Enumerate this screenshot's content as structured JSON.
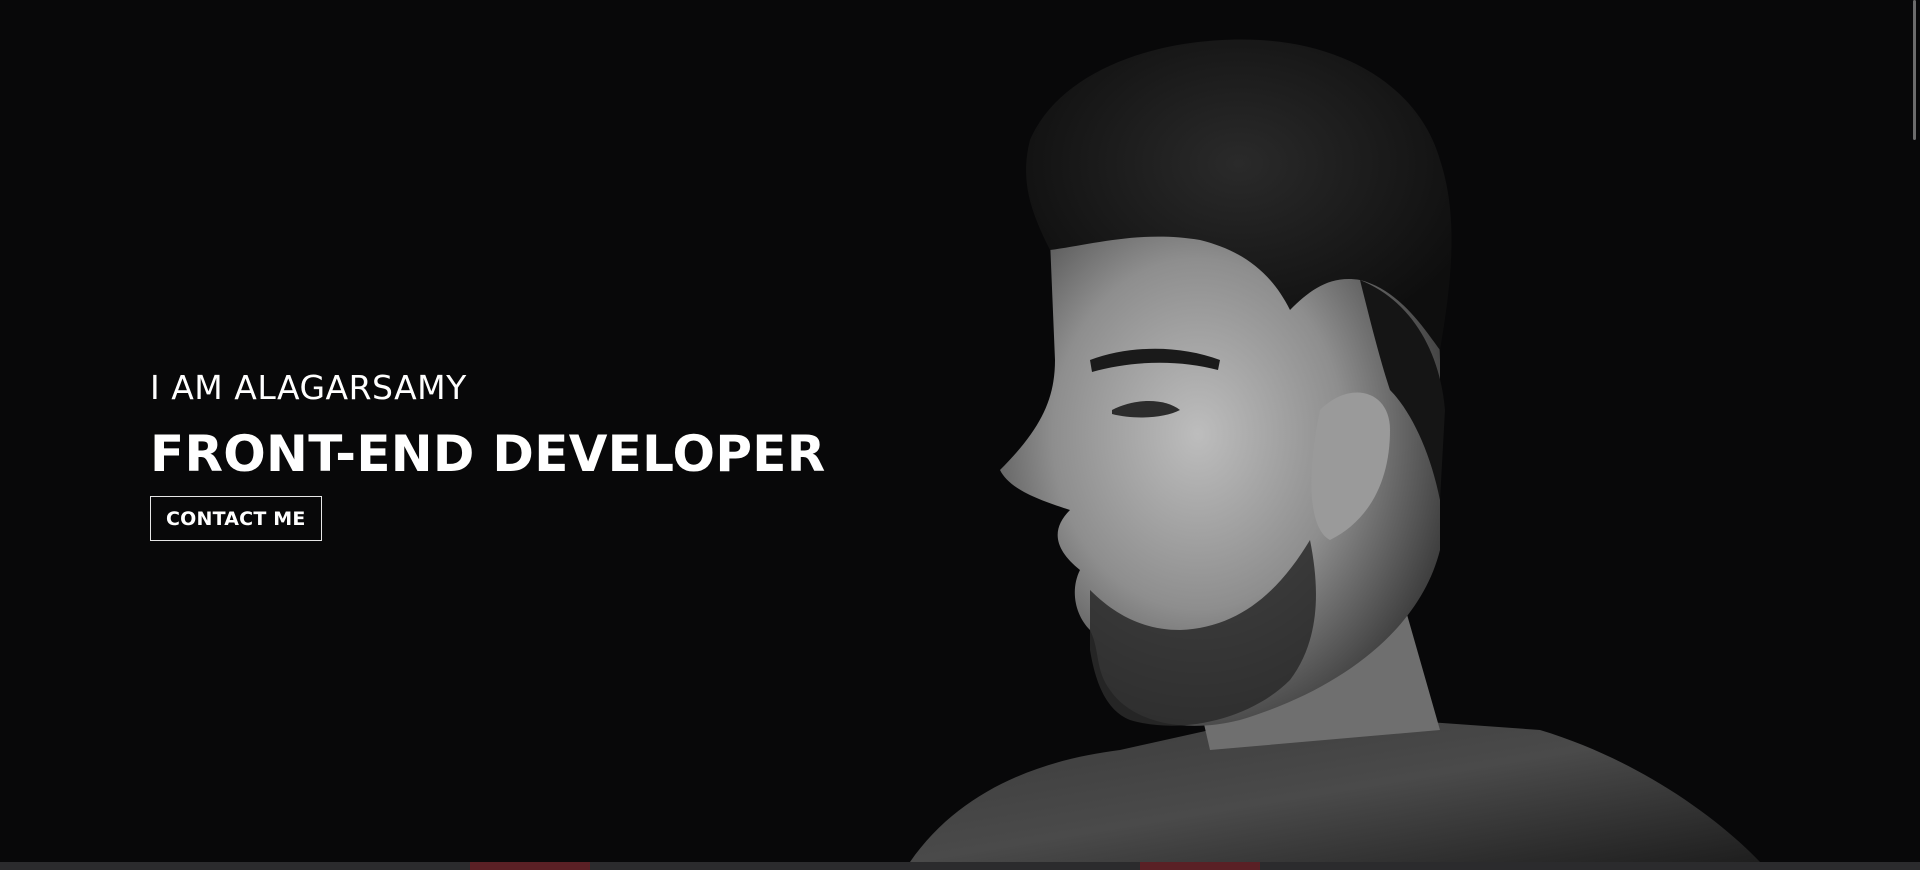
{
  "hero": {
    "intro": "I AM ALAGARSAMY",
    "role": "FRONT-END DEVELOPER",
    "contact_label": "CONTACT ME"
  },
  "colors": {
    "background": "#080809",
    "text": "#ffffff",
    "button_border": "#e6e6e6"
  }
}
